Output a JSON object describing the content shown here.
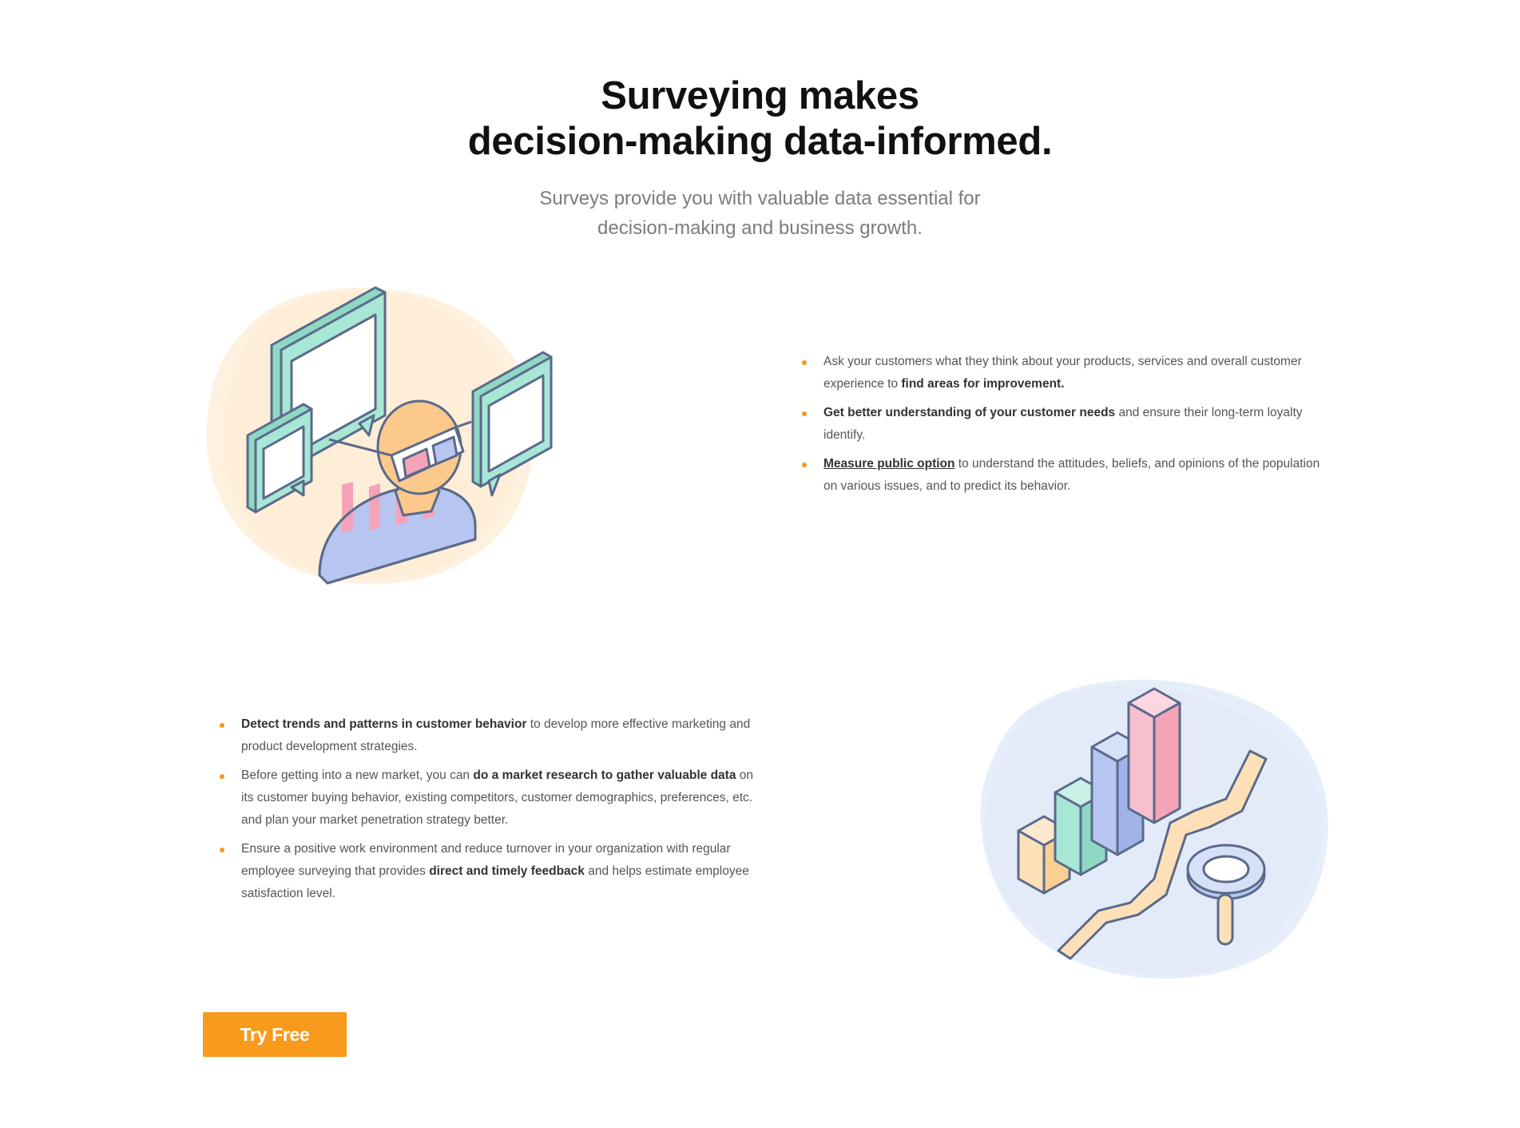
{
  "hero": {
    "title_line1": "Surveying makes",
    "title_line2": "decision-making data-informed.",
    "subtitle_line1": "Surveys provide you with valuable data essential for",
    "subtitle_line2": "decision-making and business growth."
  },
  "section1": {
    "illustration_icon": "person-with-glasses-and-speech-bubbles-icon",
    "bullets": [
      {
        "before": "Ask your customers what they think about your products, services and overall customer experience to ",
        "bold": "find areas for improvement.",
        "after": ""
      },
      {
        "before": "",
        "bold": "Get better understanding of your customer needs",
        "after": " and ensure their long-term loyalty identify."
      },
      {
        "before": "",
        "link": "Measure public option",
        "after": " to understand the attitudes, beliefs, and opinions of the population on various issues, and to predict its behavior."
      }
    ]
  },
  "section2": {
    "illustration_icon": "bar-chart-magnifier-icon",
    "bullets": [
      {
        "before": "",
        "bold": "Detect trends and patterns in customer behavior",
        "after": " to develop more effective marketing and product development strategies."
      },
      {
        "before": "Before getting into a new market, you can ",
        "bold": "do a market research to gather valuable data",
        "after": " on its customer buying behavior, existing competitors, customer demographics, preferences, etc. and plan your market penetration strategy better."
      },
      {
        "before": "Ensure a positive work environment and reduce turnover in your organization with regular employee surveying that provides ",
        "bold": "direct and timely feedback",
        "after": " and helps estimate employee satisfaction level."
      }
    ]
  },
  "cta": {
    "label": "Try Free"
  },
  "colors": {
    "accent": "#f89a1c",
    "bullet": "#f7961d",
    "outline": "#5a6a8a",
    "mint": "#a8e6d6",
    "peach": "#fde0b8",
    "pink": "#f5a3b8",
    "lavender": "#b6c6f0",
    "blob1": "#fff1e0",
    "blob2": "#e6eefb"
  }
}
